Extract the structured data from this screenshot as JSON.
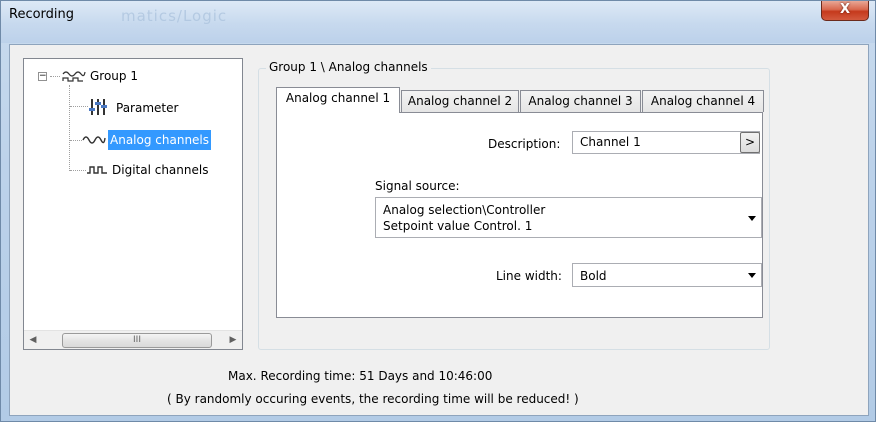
{
  "window": {
    "title": "Recording",
    "ghost_title": "matics/Logic",
    "close_label": "X"
  },
  "tree": {
    "root": {
      "label": "Group 1",
      "expander": "−",
      "icon": "wave-group-icon"
    },
    "children": [
      {
        "label": "Parameter",
        "icon": "parameter-icon"
      },
      {
        "label": "Analog channels",
        "icon": "analog-wave-icon",
        "selected": true
      },
      {
        "label": "Digital channels",
        "icon": "digital-wave-icon"
      }
    ],
    "scroll_thumb_grip": "III"
  },
  "group": {
    "title": "Group 1 \\ Analog channels",
    "tabs": [
      {
        "label": "Analog channel 1",
        "active": true
      },
      {
        "label": "Analog channel 2",
        "active": false
      },
      {
        "label": "Analog channel 3",
        "active": false
      },
      {
        "label": "Analog channel 4",
        "active": false
      }
    ]
  },
  "form": {
    "description_label": "Description:",
    "description_value": "Channel 1",
    "description_button": ">",
    "signal_source_label": "Signal source:",
    "signal_source_line1": "Analog selection\\Controller",
    "signal_source_line2": "Setpoint value Control. 1",
    "line_width_label": "Line width:",
    "line_width_value": "Bold"
  },
  "footer": {
    "recording_time": "Max. Recording time: 51 Days and 10:46:00",
    "note": "( By randomly occuring events, the recording time will be reduced! )"
  },
  "colors": {
    "selection": "#3399ff",
    "close_button": "#c5391c",
    "frame": "#bcd2ea"
  }
}
